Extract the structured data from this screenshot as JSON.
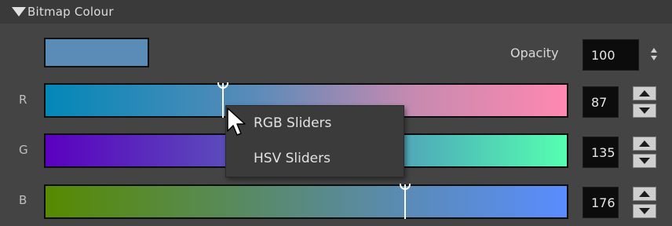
{
  "section": {
    "title": "Bitmap Colour",
    "expanded": true
  },
  "swatch": {
    "color": "#5b8cb8"
  },
  "opacity": {
    "label": "Opacity",
    "value": "100"
  },
  "channels": [
    {
      "label": "R",
      "value": "87"
    },
    {
      "label": "G",
      "value": "135"
    },
    {
      "label": "B",
      "value": "176"
    }
  ],
  "context_menu": {
    "items": [
      "RGB Sliders",
      "HSV Sliders"
    ]
  },
  "icons": {
    "collapse": "triangle-down-icon",
    "cursor": "arrow-cursor-icon"
  }
}
